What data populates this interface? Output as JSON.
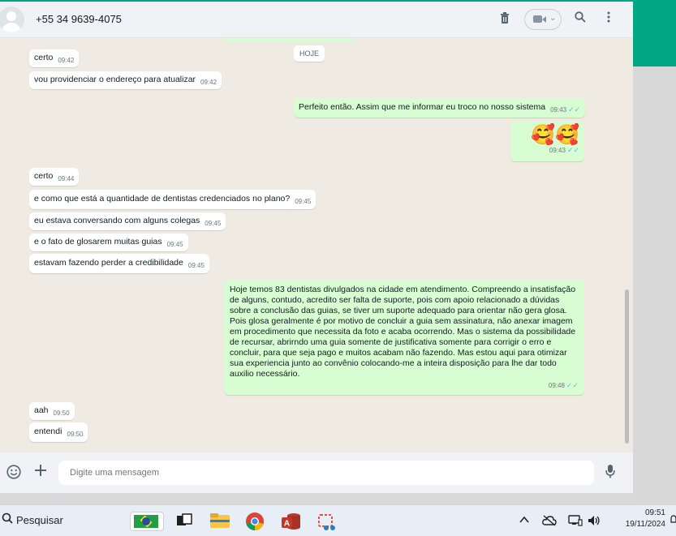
{
  "header": {
    "contact_name": "+55 34 9639-4075"
  },
  "chat": {
    "day_label": "HOJE",
    "messages": [
      {
        "dir": "in",
        "text": "certo",
        "time": "09:42"
      },
      {
        "dir": "in",
        "text": "vou providenciar o endereço para atualizar",
        "time": "09:42"
      },
      {
        "dir": "out",
        "text": "Perfeito então. Assim que me informar eu troco no nosso sistema",
        "time": "09:43"
      },
      {
        "dir": "out",
        "text": "🥰🥰",
        "time": "09:43"
      },
      {
        "dir": "in",
        "text": "certo",
        "time": "09:44"
      },
      {
        "dir": "in",
        "text": "e como que está a quantidade de dentistas credenciados no plano?",
        "time": "09:45"
      },
      {
        "dir": "in",
        "text": "eu estava conversando com alguns colegas",
        "time": "09:45"
      },
      {
        "dir": "in",
        "text": "e o fato de glosarem muitas guias",
        "time": "09:45"
      },
      {
        "dir": "in",
        "text": "estavam fazendo perder a credibilidade",
        "time": "09:45"
      },
      {
        "dir": "out",
        "text": "Hoje temos 83 dentistas divulgados na cidade em atendimento. Compreendo a insatisfação de alguns, contudo, acredito ser falta de suporte, pois com apoio relacionado a dúvidas sobre a conclusão das guias, se tiver um suporte adequado para orientar não gera glosa. Pois glosa geralmente é por motivo de concluir a guia sem assinatura, não anexar imagem em procedimento que necessita da foto e acaba ocorrendo. Mas o sistema da possibilidade de recursar, abrirndo uma guia somente de justificativa somente para corrigir o erro e concluir, para que seja pago e muitos acabam não fazendo. Mas estou aqui para otimizar sua experiencia junto ao convênio colocando-me a inteira disposição para lhe dar todo auxilio necessário.",
        "time": "09:48"
      },
      {
        "dir": "in",
        "text": "aah",
        "time": "09:50"
      },
      {
        "dir": "in",
        "text": "entendi",
        "time": "09:50"
      }
    ]
  },
  "composer": {
    "placeholder": "Digite uma mensagem"
  },
  "taskbar": {
    "search_label": "Pesquisar",
    "time": "09:51",
    "date": "19/11/2024"
  }
}
